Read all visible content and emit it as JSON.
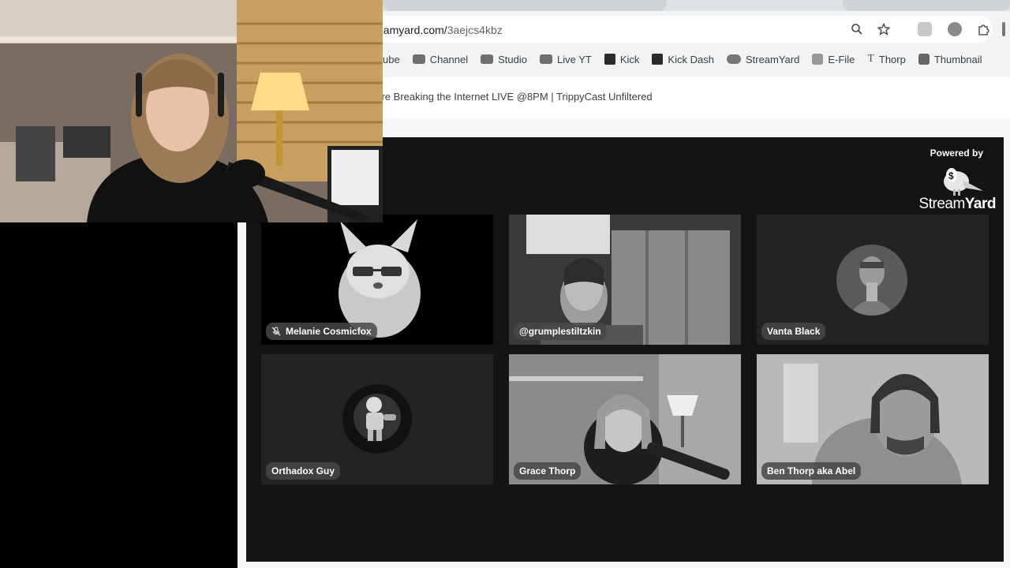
{
  "browser": {
    "url_visible": "eamyard.com/",
    "url_path": "3aejcs4kbz",
    "bookmarks": [
      {
        "label": "ube",
        "icon": "youtube-icon"
      },
      {
        "label": "Channel",
        "icon": "youtube-icon"
      },
      {
        "label": "Studio",
        "icon": "youtube-icon"
      },
      {
        "label": "Live YT",
        "icon": "youtube-icon"
      },
      {
        "label": "Kick",
        "icon": "kick-icon"
      },
      {
        "label": "Kick Dash",
        "icon": "kick-icon"
      },
      {
        "label": "StreamYard",
        "icon": "streamyard-icon"
      },
      {
        "label": "E-File",
        "icon": "efile-icon"
      },
      {
        "label": "Thorp",
        "icon": "text-t-icon"
      },
      {
        "label": "Thumbnail",
        "icon": "thumbnail-icon"
      }
    ],
    "page_title": "'re Breaking the Internet LIVE @8PM | TrippyCast Unfiltered"
  },
  "stage": {
    "powered_by": "Powered by",
    "brand_light": "Stream",
    "brand_bold": "Yard",
    "participants": [
      {
        "name": "Melanie Cosmicfox",
        "muted": true
      },
      {
        "name": "@grumplestiltzkin",
        "muted": false
      },
      {
        "name": "Vanta Black",
        "muted": false
      },
      {
        "name": "Orthadox Guy",
        "muted": false
      },
      {
        "name": "Grace Thorp",
        "muted": false
      },
      {
        "name": "Ben Thorp aka Abel",
        "muted": false
      }
    ]
  }
}
